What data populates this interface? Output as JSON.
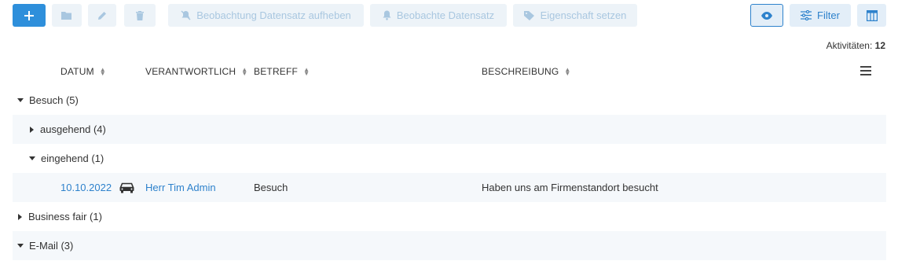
{
  "toolbar": {
    "add_icon": "plus-icon",
    "open_icon": "folder-icon",
    "edit_icon": "pencil-icon",
    "delete_icon": "trash-icon",
    "unwatch_label": "Beobachtung Datensatz aufheben",
    "watched_label": "Beobachte Datensatz",
    "set_property_label": "Eigenschaft setzen",
    "view_icon": "eye-icon",
    "filter_label": "Filter",
    "columns_icon": "columns-icon"
  },
  "summary": {
    "label": "Aktivitäten:",
    "count": "12"
  },
  "columns": {
    "date": "DATUM",
    "responsible": "VERANTWORTLICH",
    "subject": "BETREFF",
    "description": "BESCHREIBUNG"
  },
  "groups": {
    "besuch": "Besuch (5)",
    "ausgehend": "ausgehend (4)",
    "eingehend": "eingehend (1)",
    "business_fair": "Business fair (1)",
    "email": "E-Mail (3)"
  },
  "record": {
    "date": "10.10.2022",
    "type_icon": "car-icon",
    "responsible": "Herr Tim Admin",
    "subject": "Besuch",
    "description": "Haben uns am Firmenstandort besucht"
  },
  "colors": {
    "primary": "#2e8fdb",
    "link": "#2e82cc",
    "row_alt": "#f5f8fb",
    "disabled_bg": "#edf3f8"
  }
}
